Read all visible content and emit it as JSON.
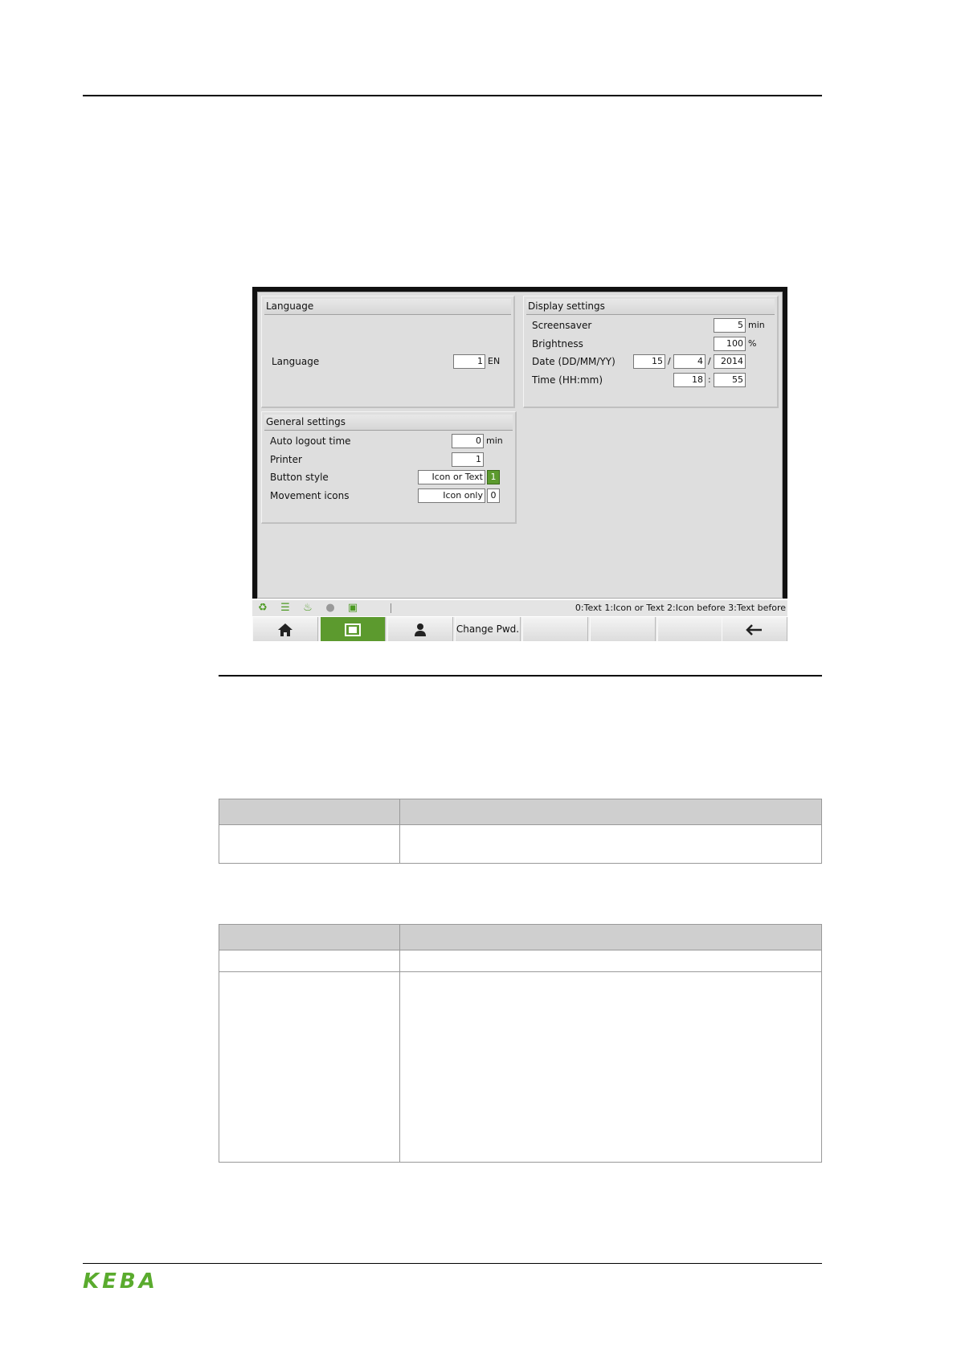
{
  "hmi": {
    "language_panel": {
      "title": "Language",
      "language_label": "Language",
      "language_value": "1",
      "language_code": "EN"
    },
    "display_panel": {
      "title": "Display settings",
      "screensaver_label": "Screensaver",
      "screensaver_value": "5",
      "screensaver_unit": "min",
      "brightness_label": "Brightness",
      "brightness_value": "100",
      "brightness_unit": "%",
      "date_label": "Date (DD/MM/YY)",
      "date_day": "15",
      "date_month": "4",
      "date_year": "2014",
      "date_sep": "/",
      "time_label": "Time (HH:mm)",
      "time_hour": "18",
      "time_minute": "55",
      "time_sep": ":"
    },
    "general_panel": {
      "title": "General settings",
      "auto_logout_label": "Auto logout time",
      "auto_logout_value": "0",
      "auto_logout_unit": "min",
      "printer_label": "Printer",
      "printer_value": "1",
      "button_style_label": "Button style",
      "button_style_text": "Icon or Text",
      "button_style_value": "1",
      "movement_icons_label": "Movement icons",
      "movement_icons_text": "Icon only",
      "movement_icons_value": "0"
    },
    "status_bar": {
      "hint": "0:Text 1:Icon or Text 2:Icon before 3:Text before",
      "icons": [
        "recycle-icon",
        "list-icon",
        "heating-icon",
        "drop-icon",
        "mold-icon"
      ]
    },
    "buttons": {
      "change_pwd": "Change Pwd."
    },
    "colors": {
      "accent_green": "#5c9a2e"
    }
  },
  "footer": {
    "logo_text": "KEBA"
  }
}
